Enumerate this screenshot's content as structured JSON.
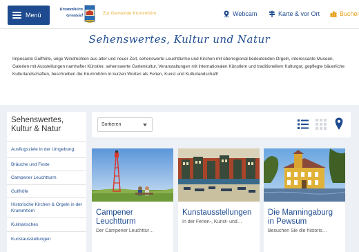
{
  "header": {
    "menu_label": "Menü",
    "logo_line1": "Krummhörn",
    "logo_line2": "Greetsiel",
    "gemeinde_link": "Zur Gemeinde Krummhörn",
    "nav": [
      {
        "label": "Webcam",
        "icon": "map-pin-icon"
      },
      {
        "label": "Karte & vor Ort",
        "icon": "signpost-icon"
      },
      {
        "label": "Buchen",
        "icon": "buildings-icon"
      }
    ],
    "brand_color": "#1e4b8f",
    "accent_color": "#e8a21d"
  },
  "page": {
    "title": "Sehenswertes, Kultur und Natur",
    "intro": "Imposante Gulfhöfe, urige Windmühlen aus alter und neuer Zeit, sehenswerte Leuchttürme und  Kirchen mit überregional bedeutenden Orgeln, interessante Museen, Galerien mit Ausstellungen namhafter Künstler, sehenswerte Gartenkultur, Veranstaltungen mit internationalen Künstlern und traditionellem Kulturgut, gepflegte bäuerliche Kulturlandschaften, beschreiben die Krummhörn in kurzen Worten als Ferien, Kunst und Kulturlandschaft!"
  },
  "sidebar": {
    "title": "Sehenswertes, Kultur & Natur",
    "items": [
      {
        "label": "Ausflugsziele in der Umgebung"
      },
      {
        "label": "Bräuche und Feste"
      },
      {
        "label": "Campener Leuchtturm"
      },
      {
        "label": "Gulfhöfe"
      },
      {
        "label": "Historische Kirchen & Orgeln in der Krummhörn"
      },
      {
        "label": "Kulinarisches"
      },
      {
        "label": "Kunstausstellungen"
      }
    ]
  },
  "toolbar": {
    "sort_label": "Sortieren",
    "icons": [
      "list-view-icon",
      "grid-view-icon",
      "map-view-icon"
    ]
  },
  "cards": [
    {
      "title": "Campener Leuchtturm",
      "teaser": "Der Campener Leuchttur…"
    },
    {
      "title": "Kunstausstellungen",
      "teaser": "In der Ferien-, Kunst- und…"
    },
    {
      "title": "Die Manningaburg in Pewsum",
      "teaser": "Besuchen Sie die historis…"
    }
  ]
}
